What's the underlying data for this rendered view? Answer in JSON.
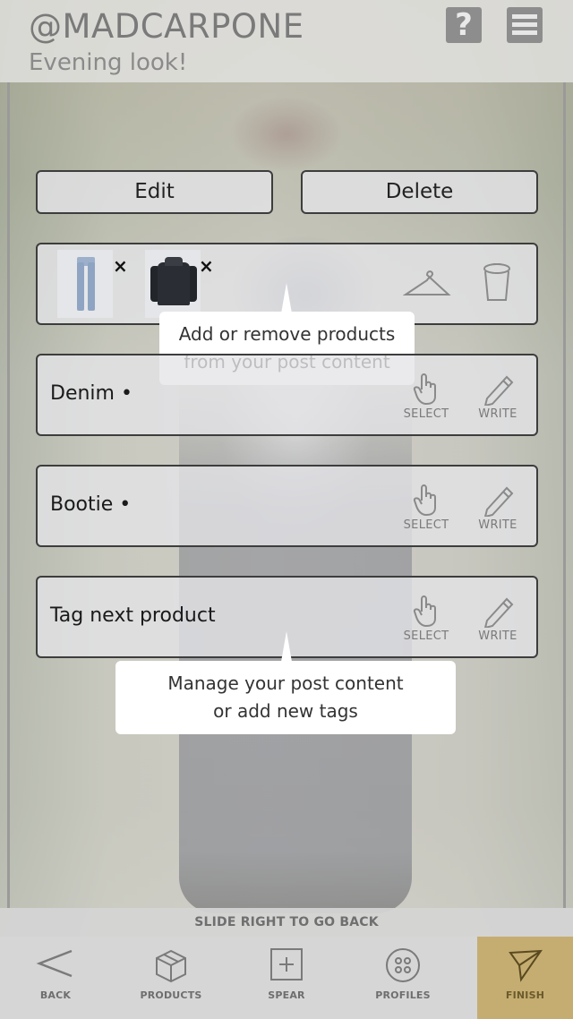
{
  "header": {
    "username": "@MADCARPONE",
    "post_title": "Evening look!",
    "help_label": "?"
  },
  "actions": {
    "edit_label": "Edit",
    "delete_label": "Delete"
  },
  "products_row": {
    "remove_mark": "×",
    "items": [
      {
        "name": "jeans",
        "icon": "jeans-thumbnail"
      },
      {
        "name": "jacket",
        "icon": "jacket-thumbnail"
      }
    ]
  },
  "tooltips": {
    "products": {
      "line1": "Add or remove products",
      "line2": "from your post content"
    },
    "manage": {
      "line1": "Manage your post content",
      "line2": "or add new tags"
    }
  },
  "tags": [
    {
      "label": "Denim •",
      "select": "SELECT",
      "write": "WRITE"
    },
    {
      "label": "Bootie •",
      "select": "SELECT",
      "write": "WRITE"
    },
    {
      "label": "Tag next product",
      "select": "SELECT",
      "write": "WRITE"
    }
  ],
  "slide_hint": "SLIDE RIGHT TO GO BACK",
  "nav": {
    "back": "BACK",
    "products": "PRODUCTS",
    "spear": "SPEAR",
    "profiles": "PROFILES",
    "finish": "FINISH"
  },
  "colors": {
    "accent_finish": "#c5ad71",
    "panel_border": "#3d3d3d",
    "text_gray": "#7a7a7a"
  }
}
